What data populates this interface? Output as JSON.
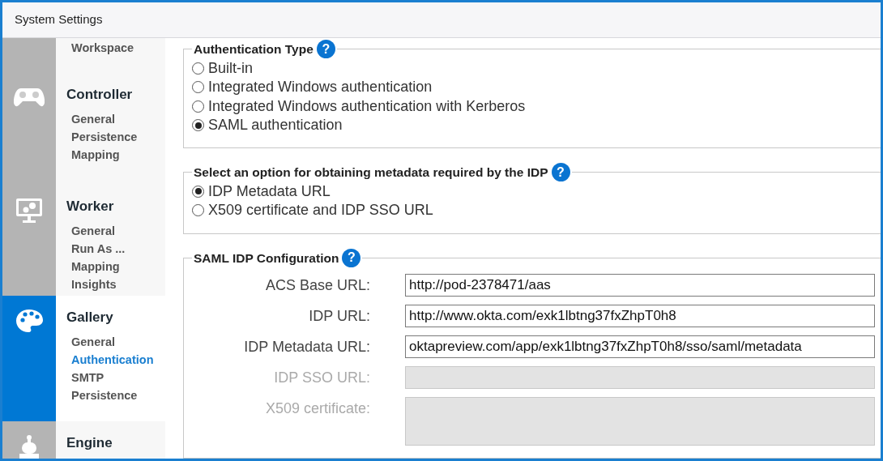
{
  "window": {
    "title": "System Settings"
  },
  "sidebar": {
    "groups": [
      {
        "selected": false,
        "items": [
          {
            "label": "Workspace",
            "selected": false
          }
        ]
      },
      {
        "name": "Controller",
        "selected": false,
        "items": [
          {
            "label": "General",
            "selected": false
          },
          {
            "label": "Persistence",
            "selected": false
          },
          {
            "label": "Mapping",
            "selected": false
          }
        ]
      },
      {
        "name": "Worker",
        "selected": false,
        "items": [
          {
            "label": "General",
            "selected": false
          },
          {
            "label": "Run As ...",
            "selected": false
          },
          {
            "label": "Mapping",
            "selected": false
          },
          {
            "label": "Insights",
            "selected": false
          }
        ]
      },
      {
        "name": "Gallery",
        "selected": true,
        "items": [
          {
            "label": "General",
            "selected": false
          },
          {
            "label": "Authentication",
            "selected": true
          },
          {
            "label": "SMTP",
            "selected": false
          },
          {
            "label": "Persistence",
            "selected": false
          }
        ]
      },
      {
        "name": "Engine",
        "selected": false
      }
    ]
  },
  "sections": [
    {
      "kind": "radios",
      "legend": "Authentication Type",
      "help": "?",
      "options": [
        {
          "label": "Built-in",
          "selected": false
        },
        {
          "label": "Integrated Windows authentication",
          "selected": false
        },
        {
          "label": "Integrated Windows authentication with Kerberos",
          "selected": false
        },
        {
          "label": "SAML authentication",
          "selected": true
        }
      ]
    },
    {
      "kind": "radios",
      "legend": "Select an option for obtaining metadata required by the IDP",
      "help": "?",
      "options": [
        {
          "label": "IDP Metadata URL",
          "selected": true
        },
        {
          "label": "X509 certificate and IDP SSO URL",
          "selected": false
        }
      ]
    },
    {
      "kind": "fields",
      "legend": "SAML IDP Configuration",
      "help": "?",
      "fields": [
        {
          "label": "ACS Base URL:",
          "value": "http://pod-2378471/aas",
          "disabled": false,
          "kind": "line"
        },
        {
          "label": "IDP URL:",
          "value": "http://www.okta.com/exk1lbtng37fxZhpT0h8",
          "disabled": false,
          "kind": "line"
        },
        {
          "label": "IDP Metadata URL:",
          "value": "oktapreview.com/app/exk1lbtng37fxZhpT0h8/sso/saml/metadata",
          "disabled": false,
          "kind": "line"
        },
        {
          "label": "IDP SSO URL:",
          "disabled": true,
          "kind": "line"
        },
        {
          "label": "X509 certificate:",
          "disabled": true,
          "kind": "area"
        }
      ]
    }
  ]
}
